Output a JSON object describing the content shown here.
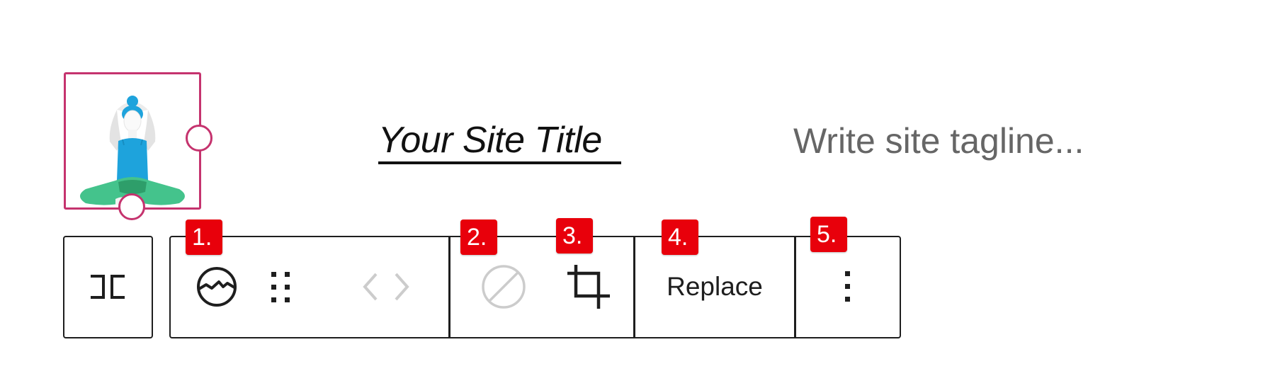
{
  "header": {
    "site_title": "Your Site Title",
    "tagline_placeholder": "Write site tagline..."
  },
  "logo": {
    "image": "yoga-woman-illustration",
    "selection_color": "#c5336e"
  },
  "toolbar": {
    "transform_icon": "align-icon",
    "site_logo_icon": "site-logo-icon",
    "drag_icon": "drag-handle-icon",
    "move_left_icon": "chevron-left-icon",
    "move_right_icon": "chevron-right-icon",
    "reset_icon": "no-entry-icon",
    "crop_icon": "crop-icon",
    "replace_label": "Replace",
    "more_icon": "more-vertical-icon"
  },
  "badges": [
    "1.",
    "2.",
    "3.",
    "4.",
    "5."
  ],
  "colors": {
    "badge": "#e8000b",
    "toolbar_border": "#1e1e1e",
    "disabled_icon": "#cccccc",
    "tagline": "#666666"
  }
}
